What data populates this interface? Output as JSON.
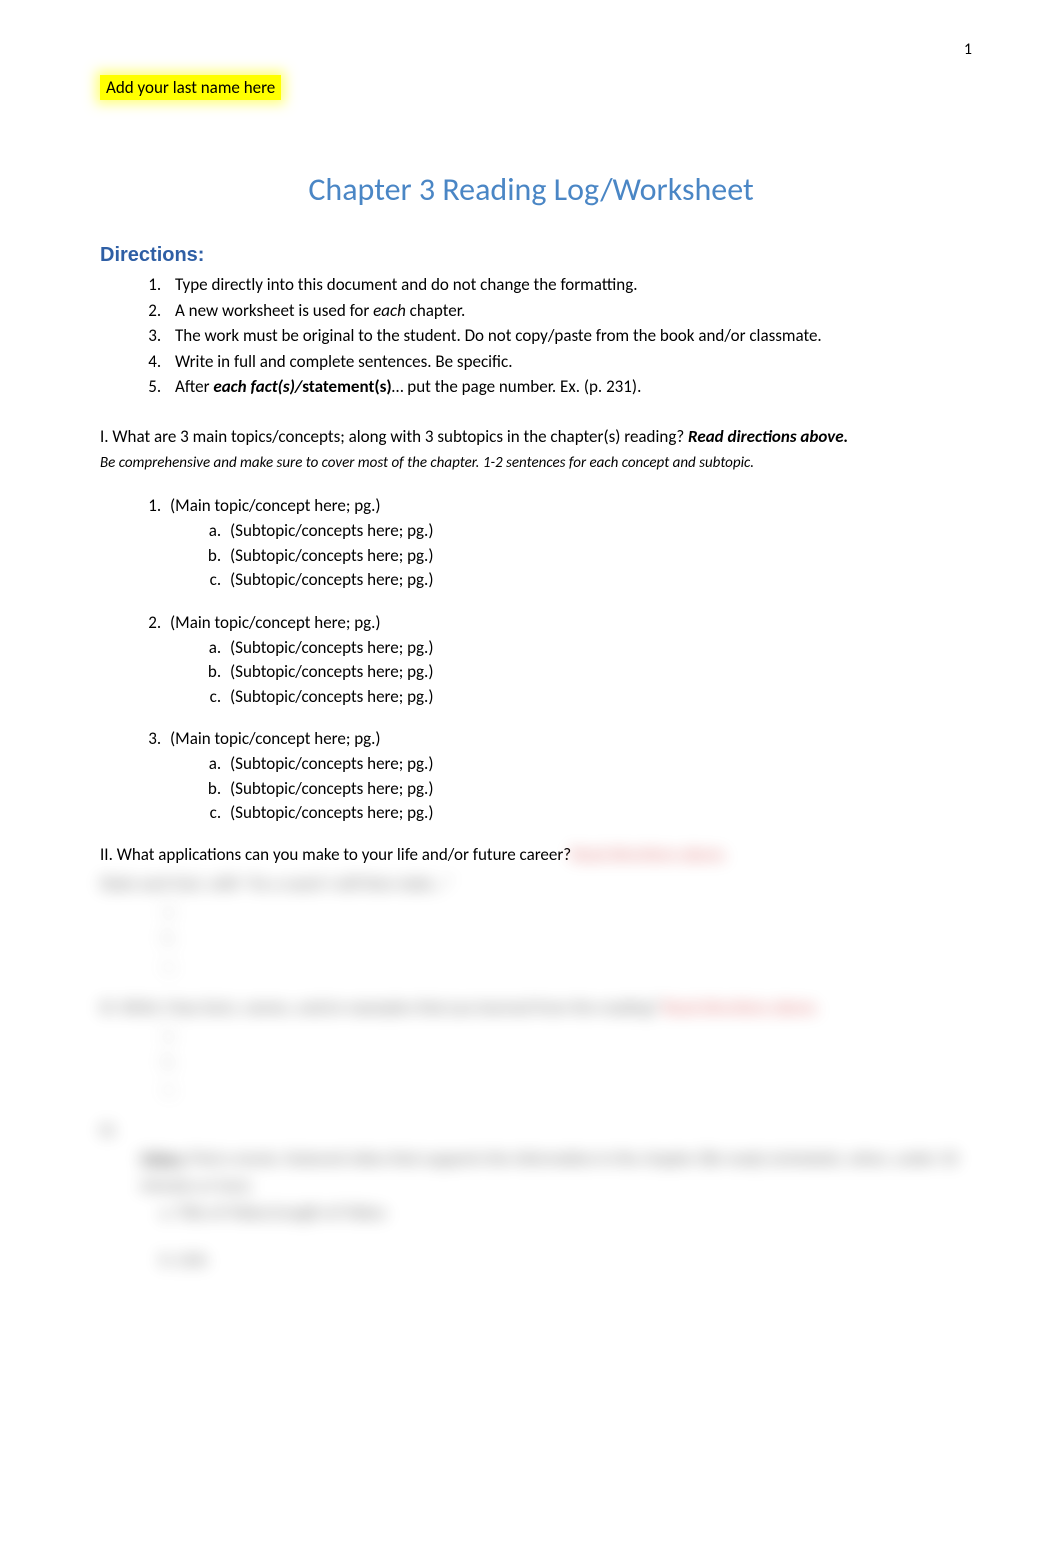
{
  "pageNumber": "1",
  "lastNamePrompt": "Add your last name here",
  "title": "Chapter 3 Reading Log/Worksheet",
  "directionsHeading": "Directions:",
  "directions": [
    {
      "text": "Type directly into this document and do not change the formatting."
    },
    {
      "prefix": "A new worksheet is used for ",
      "italic": "each",
      "suffix": " chapter."
    },
    {
      "text": "The work must be original to the student. Do not copy/paste from the book and/or classmate."
    },
    {
      "text": "Write in full and complete sentences. Be specific."
    },
    {
      "prefix": "After ",
      "boldItalic": "each fact(s)/",
      "bold": "statement(s)",
      "suffix": "… put the page number. Ex. (p. 231)."
    }
  ],
  "sectionI": {
    "intro": "I. What are 3 main topics/concepts; along with 3 subtopics in the chapter(s) reading? ",
    "introBold": "Read directions above.",
    "subtext": "Be comprehensive and make sure to cover most of the chapter. 1-2 sentences for each concept and subtopic."
  },
  "topics": [
    {
      "main": "(Main topic/concept here; pg.)",
      "subs": [
        "(Subtopic/concepts here; pg.)",
        "(Subtopic/concepts here; pg.)",
        "(Subtopic/concepts here; pg.)"
      ]
    },
    {
      "main": "(Main topic/concept here; pg.)",
      "subs": [
        "(Subtopic/concepts here; pg.)",
        "(Subtopic/concepts here; pg.)",
        "(Subtopic/concepts here; pg.)"
      ]
    },
    {
      "main": "(Main topic/concept here; pg.)",
      "subs": [
        "(Subtopic/concepts here; pg.)",
        "(Subtopic/concepts here; pg.)",
        "(Subtopic/concepts here; pg.)"
      ]
    }
  ],
  "sectionII": {
    "text": "II. What applications can you make to your life and/or future career?"
  },
  "blurred": {
    "line1_red": "Read directions above.",
    "line2": "State each fact, with \"As a coach I will then state…\"",
    "list1": [
      "a.",
      "b.",
      "c."
    ],
    "sectionIII": "III. Write 3 key facts, names, and/or examples that you learned from the reading?",
    "sectionIII_red": "Read directions above.",
    "list2": [
      "a.",
      "b.",
      "c."
    ],
    "sectionIV": "IV.",
    "videoLabel": "Video:",
    "videoText": " Find a movie, featured video that supports the information in the chapter (Be ready (schedule), when, under 10 minutes or less).",
    "videoSub": "a. Title of Video/Length of Video:",
    "link": "b. Link:"
  }
}
